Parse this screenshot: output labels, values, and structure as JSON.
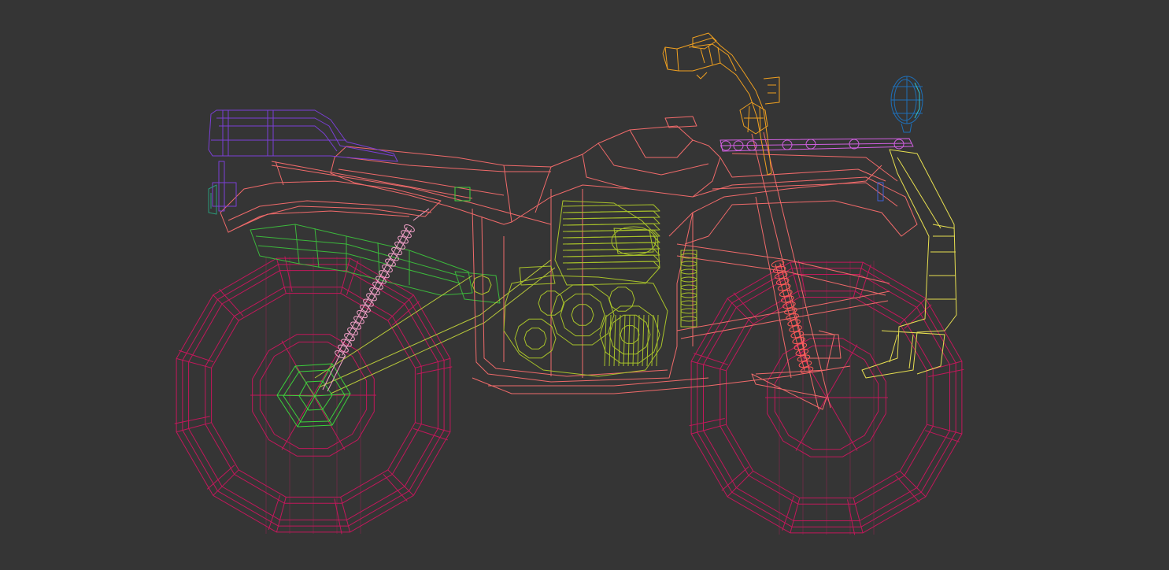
{
  "viewport": {
    "background": "#353535",
    "view": "side-orthographic",
    "render_mode": "wireframe"
  },
  "model": {
    "subject": "motorcycle",
    "parts": [
      {
        "id": "rear-wheel",
        "color": "#c2185b"
      },
      {
        "id": "front-wheel",
        "color": "#c2185b"
      },
      {
        "id": "frame",
        "color": "#f06a6a"
      },
      {
        "id": "fuel-tank-seat",
        "color": "#f06a6a"
      },
      {
        "id": "engine",
        "color": "#a8c22a"
      },
      {
        "id": "exhaust",
        "color": "#3cb83c"
      },
      {
        "id": "rear-shock",
        "color": "#f2a0c8"
      },
      {
        "id": "rear-hub",
        "color": "#3cd23c"
      },
      {
        "id": "rear-rack",
        "color": "#7b3fd6"
      },
      {
        "id": "handlebar",
        "color": "#f0a020"
      },
      {
        "id": "front-fork-spring",
        "color": "#ff5a5a"
      },
      {
        "id": "top-bar",
        "color": "#d060e0"
      },
      {
        "id": "headlight",
        "color": "#1e6fb8"
      },
      {
        "id": "front-guard",
        "color": "#e8e050"
      },
      {
        "id": "taillight",
        "color": "#2a9a7a"
      }
    ]
  }
}
